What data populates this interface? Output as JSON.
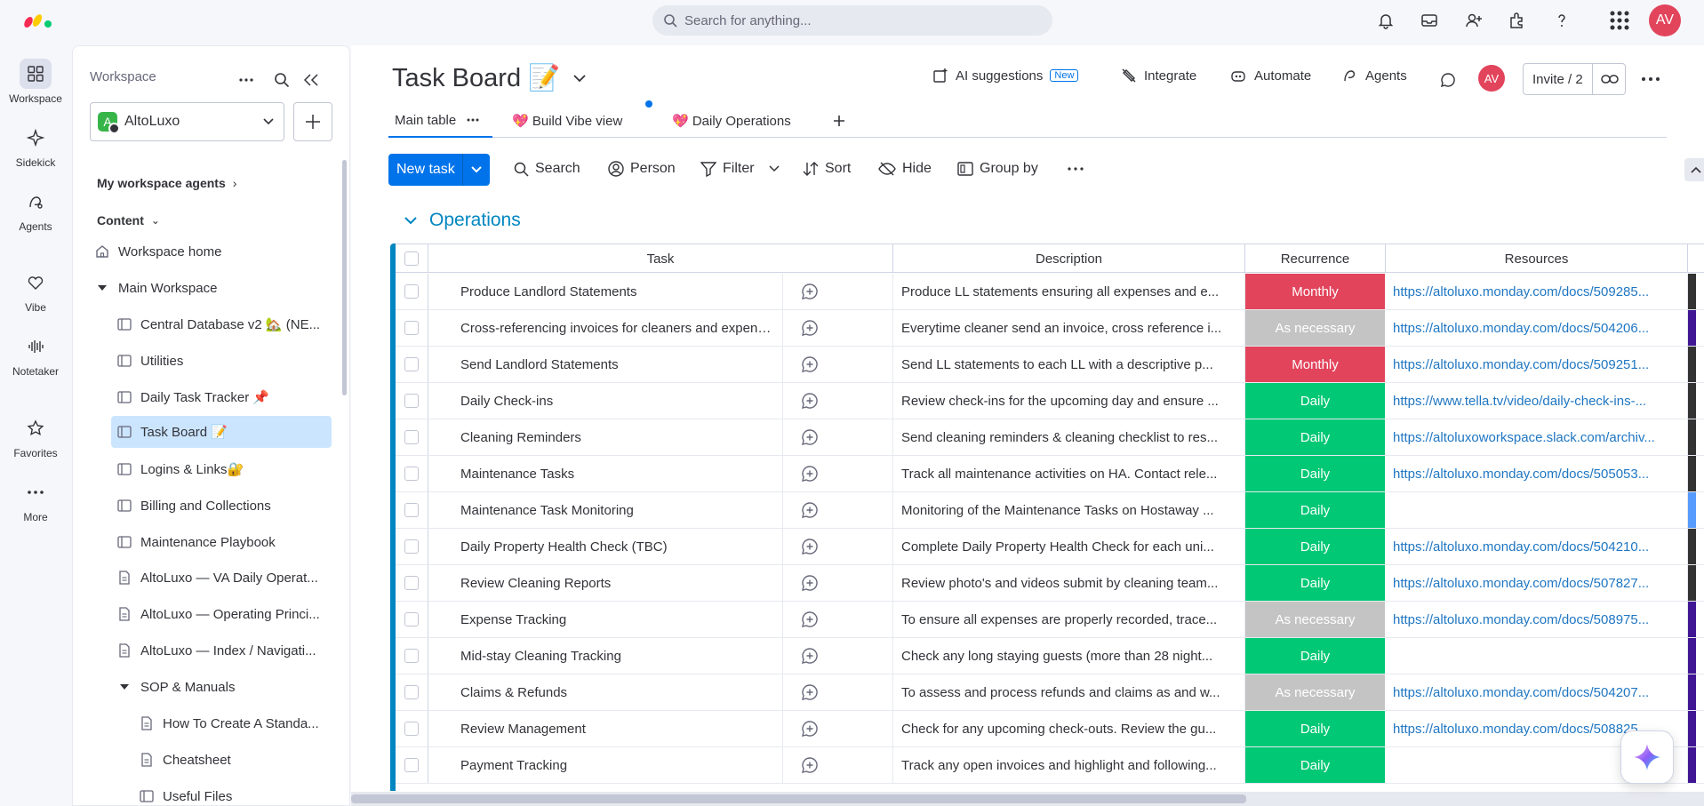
{
  "topbar": {
    "search_placeholder": "Search for anything...",
    "avatar_initials": "AV"
  },
  "rail": [
    {
      "label": "Workspace",
      "icon": "grid-icon",
      "active": true
    },
    {
      "label": "Sidekick",
      "icon": "sidekick-icon"
    },
    {
      "label": "Agents",
      "icon": "agents-icon"
    },
    {
      "label": "Vibe",
      "icon": "vibe-icon"
    },
    {
      "label": "Notetaker",
      "icon": "notetaker-icon"
    },
    {
      "label": "Favorites",
      "icon": "star-icon"
    },
    {
      "label": "More",
      "icon": "more-icon"
    }
  ],
  "sidebar": {
    "title": "Workspace",
    "workspace_name": "AltoLuxo",
    "workspace_initial": "A",
    "items": [
      {
        "label": "My workspace agents",
        "type": "section",
        "suffix": "›"
      },
      {
        "label": "Content",
        "type": "section",
        "suffix": "⌄"
      },
      {
        "label": "Workspace home",
        "type": "home"
      },
      {
        "label": "Main Workspace",
        "type": "folder"
      },
      {
        "label": "Central Database v2 🏡 (NE...",
        "type": "board"
      },
      {
        "label": "Utilities",
        "type": "board"
      },
      {
        "label": "Daily Task Tracker 📌",
        "type": "board"
      },
      {
        "label": "Task Board 📝",
        "type": "board",
        "selected": true
      },
      {
        "label": "Logins & Links🔐",
        "type": "board"
      },
      {
        "label": "Billing and Collections",
        "type": "board"
      },
      {
        "label": "Maintenance Playbook",
        "type": "board"
      },
      {
        "label": "AltoLuxo — VA Daily Operat...",
        "type": "doc"
      },
      {
        "label": "AltoLuxo — Operating Princi...",
        "type": "doc"
      },
      {
        "label": "AltoLuxo — Index / Navigati...",
        "type": "doc"
      },
      {
        "label": "SOP & Manuals",
        "type": "folder"
      },
      {
        "label": "How To Create A Standa...",
        "type": "doc"
      },
      {
        "label": "Cheatsheet",
        "type": "doc"
      },
      {
        "label": "Useful Files",
        "type": "board"
      }
    ]
  },
  "board": {
    "title": "Task Board 📝",
    "actions": {
      "ai": "AI suggestions",
      "ai_badge": "New",
      "integrate": "Integrate",
      "automate": "Automate",
      "agents": "Agents",
      "avatar": "AV",
      "invite": "Invite / 2"
    },
    "tabs": [
      {
        "label": "Main table",
        "active": true
      },
      {
        "label": "💖 Build Vibe view"
      },
      {
        "label": "💖 Daily Operations"
      }
    ],
    "toolbar": {
      "new_task": "New task",
      "search": "Search",
      "person": "Person",
      "filter": "Filter",
      "sort": "Sort",
      "hide": "Hide",
      "group_by": "Group by"
    },
    "group": {
      "title": "Operations",
      "color": "#0086c0"
    },
    "columns": {
      "task": "Task",
      "description": "Description",
      "recurrence": "Recurrence",
      "resources": "Resources"
    },
    "recurrence_colors": {
      "Monthly": "#e2445c",
      "As necessary": "#c4c4c4",
      "Daily": "#00c875"
    },
    "rows": [
      {
        "task": "Produce Landlord Statements",
        "description": "Produce LL statements ensuring all expenses and e...",
        "recurrence": "Monthly",
        "resources": "https://altoluxo.monday.com/docs/509285...",
        "edge": "#333333"
      },
      {
        "task": "Cross-referencing invoices for cleaners and expenses a...",
        "description": "Everytime cleaner send an invoice, cross reference i...",
        "recurrence": "As necessary",
        "resources": "https://altoluxo.monday.com/docs/504206...",
        "edge": "#401694"
      },
      {
        "task": "Send Landlord Statements",
        "description": "Send LL statements to each LL with a descriptive p...",
        "recurrence": "Monthly",
        "resources": "https://altoluxo.monday.com/docs/509251...",
        "edge": "#333333"
      },
      {
        "task": "Daily Check-ins",
        "description": "Review check-ins for the upcoming day and ensure ...",
        "recurrence": "Daily",
        "resources": "https://www.tella.tv/video/daily-check-ins-...",
        "edge": "#333333"
      },
      {
        "task": "Cleaning Reminders",
        "description": "Send cleaning reminders & cleaning checklist to res...",
        "recurrence": "Daily",
        "resources": "https://altoluxoworkspace.slack.com/archiv...",
        "edge": "#333333"
      },
      {
        "task": "Maintenance Tasks",
        "description": "Track all maintenance activities on HA. Contact rele...",
        "recurrence": "Daily",
        "resources": "https://altoluxo.monday.com/docs/505053...",
        "edge": "#333333"
      },
      {
        "task": "Maintenance Task Monitoring",
        "description": "Monitoring of the Maintenance Tasks on Hostaway ...",
        "recurrence": "Daily",
        "resources": "",
        "edge": "#579bfc"
      },
      {
        "task": "Daily Property Health Check (TBC)",
        "description": "Complete Daily Property Health Check for each uni...",
        "recurrence": "Daily",
        "resources": "https://altoluxo.monday.com/docs/504210...",
        "edge": "#333333"
      },
      {
        "task": "Review Cleaning Reports",
        "description": "Review photo's and videos submit by cleaning team...",
        "recurrence": "Daily",
        "resources": "https://altoluxo.monday.com/docs/507827...",
        "edge": "#333333"
      },
      {
        "task": "Expense Tracking",
        "description": "To ensure all expenses are properly recorded, trace...",
        "recurrence": "As necessary",
        "resources": "https://altoluxo.monday.com/docs/508975...",
        "edge": "#401694"
      },
      {
        "task": "Mid-stay Cleaning Tracking",
        "description": "Check any long staying guests (more than 28 night...",
        "recurrence": "Daily",
        "resources": "",
        "edge": "#401694"
      },
      {
        "task": "Claims & Refunds",
        "description": "To assess and process refunds and claims as and w...",
        "recurrence": "As necessary",
        "resources": "https://altoluxo.monday.com/docs/504207...",
        "edge": "#401694"
      },
      {
        "task": "Review Management",
        "description": "Check for any upcoming check-outs. Review the gu...",
        "recurrence": "Daily",
        "resources": "https://altoluxo.monday.com/docs/508825...",
        "edge": "#401694"
      },
      {
        "task": "Payment Tracking",
        "description": "Track any open invoices and highlight and following...",
        "recurrence": "Daily",
        "resources": "",
        "edge": "#401694"
      }
    ]
  }
}
